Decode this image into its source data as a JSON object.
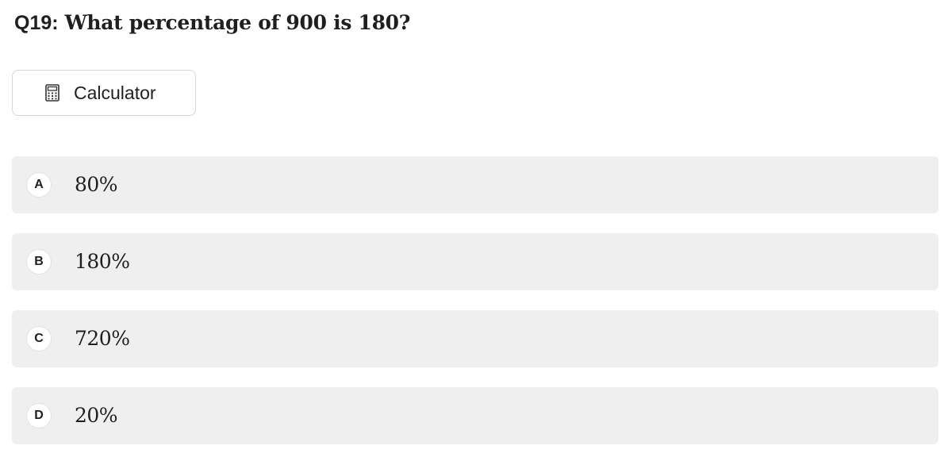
{
  "question": {
    "number": "Q19",
    "separator": ":",
    "text": "What percentage of 900 is 180?"
  },
  "calculator": {
    "label": "Calculator",
    "icon": "calculator-icon"
  },
  "options": [
    {
      "letter": "A",
      "text": "80%"
    },
    {
      "letter": "B",
      "text": "180%"
    },
    {
      "letter": "C",
      "text": "720%"
    },
    {
      "letter": "D",
      "text": "20%"
    }
  ]
}
